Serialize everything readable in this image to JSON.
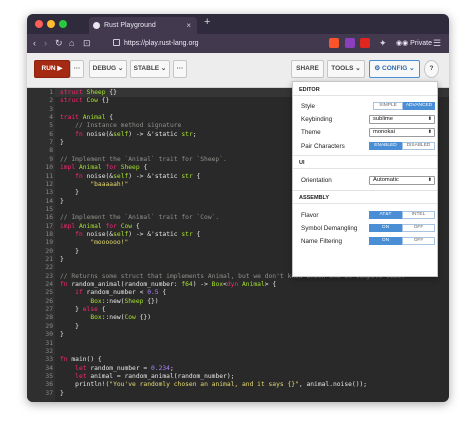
{
  "browser": {
    "tab_title": "Rust Playground",
    "tab_close": "×",
    "new_tab": "+",
    "url": "https://play.rust-lang.org",
    "private_label": "Private"
  },
  "toolbar": {
    "run_label": "RUN ▶",
    "more_label": "···",
    "mode_label": "DEBUG ⌄",
    "channel_label": "STABLE ⌄",
    "more2_label": "···",
    "share_label": "SHARE",
    "tools_label": "TOOLS ⌄",
    "config_label": "⚙ CONFIG ⌄",
    "help_label": "?"
  },
  "config": {
    "editor_heading": "EDITOR",
    "style_label": "Style",
    "style_options": [
      "SIMPLE",
      "ADVANCED"
    ],
    "style_selected": "ADVANCED",
    "keybinding_label": "Keybinding",
    "keybinding_value": "sublime",
    "theme_label": "Theme",
    "theme_value": "monokai",
    "pair_label": "Pair Characters",
    "pair_options": [
      "ENABLED",
      "DISABLED"
    ],
    "ui_heading": "UI",
    "orientation_label": "Orientation",
    "orientation_value": "Automatic",
    "assembly_heading": "ASSEMBLY",
    "flavor_label": "Flavor",
    "flavor_options": [
      "AT&T",
      "INTEL"
    ],
    "demangle_label": "Symbol Demangling",
    "demangle_options": [
      "ON",
      "OFF"
    ],
    "filter_label": "Name Filtering",
    "filter_options": [
      "ON",
      "OFF"
    ]
  },
  "editor": {
    "lines": [
      "struct Sheep {}",
      "struct Cow {}",
      "",
      "trait Animal {",
      "    // Instance method signature",
      "    fn noise(&self) -> &'static str;",
      "}",
      "",
      "// Implement the `Animal` trait for `Sheep`.",
      "impl Animal for Sheep {",
      "    fn noise(&self) -> &'static str {",
      "        \"baaaaah!\"",
      "    }",
      "}",
      "",
      "// Implement the `Animal` trait for `Cow`.",
      "impl Animal for Cow {",
      "    fn noise(&self) -> &'static str {",
      "        \"moooooo!\"",
      "    }",
      "}",
      "",
      "// Returns some struct that implements Animal, but we don't know which one at compile time.",
      "fn random_animal(random_number: f64) -> Box<dyn Animal> {",
      "    if random_number < 0.5 {",
      "        Box::new(Sheep {})",
      "    } else {",
      "        Box::new(Cow {})",
      "    }",
      "}",
      "",
      "",
      "fn main() {",
      "    let random_number = 0.234;",
      "    let animal = random_animal(random_number);",
      "    println!(\"You've randomly chosen an animal, and it says {}\", animal.noise());",
      "}"
    ]
  },
  "colors": {
    "keyword": "#f92672",
    "type": "#a6e22e",
    "string": "#e6db74",
    "comment": "#8f908a",
    "number": "#ae81ff",
    "fn_name": "#a6e22e",
    "plain": "#e8e8e8"
  }
}
